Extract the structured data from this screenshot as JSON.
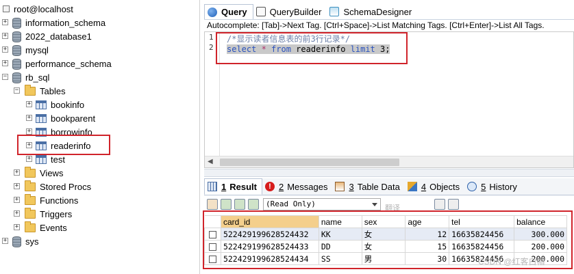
{
  "tree": {
    "host": "root@localhost",
    "databases": [
      "information_schema",
      "2022_database1",
      "mysql",
      "performance_schema",
      "rb_sql"
    ],
    "tables_folder": "Tables",
    "tables": [
      "bookinfo",
      "bookparent",
      "borrowinfo",
      "readerinfo",
      "test"
    ],
    "folders": [
      "Views",
      "Stored Procs",
      "Functions",
      "Triggers",
      "Events"
    ],
    "last_db": "sys"
  },
  "tabs": [
    "Query",
    "QueryBuilder",
    "SchemaDesigner"
  ],
  "autocomplete": "Autocomplete: [Tab]->Next Tag. [Ctrl+Space]->List Matching Tags. [Ctrl+Enter]->List All Tags.",
  "editor": {
    "line_numbers": [
      "1",
      "2"
    ],
    "line1": "/*显示读者信息表的前3行记录*/",
    "kw_select": "select",
    "star": " *",
    "kw_from": "from",
    "table": " readerinfo ",
    "kw_limit": "limit",
    "end": " 3;"
  },
  "result_tabs": [
    {
      "num": "1",
      "label": "Result"
    },
    {
      "num": "2",
      "label": "Messages"
    },
    {
      "num": "3",
      "label": "Table Data"
    },
    {
      "num": "4",
      "label": "Objects"
    },
    {
      "num": "5",
      "label": "History"
    }
  ],
  "readonly": "(Read Only)",
  "translate_hint": "翻译",
  "grid": {
    "columns": [
      "card_id",
      "name",
      "sex",
      "age",
      "tel",
      "balance"
    ],
    "rows": [
      [
        "522429199628524432",
        "KK",
        "女",
        "12",
        "16635824456",
        "300.000"
      ],
      [
        "522429199628524433",
        "DD",
        "女",
        "15",
        "16635824456",
        "200.000"
      ],
      [
        "522429199628524434",
        "SS",
        "男",
        "30",
        "16635824456",
        "200.000"
      ]
    ]
  },
  "watermark": "CSDN @红客白帽"
}
